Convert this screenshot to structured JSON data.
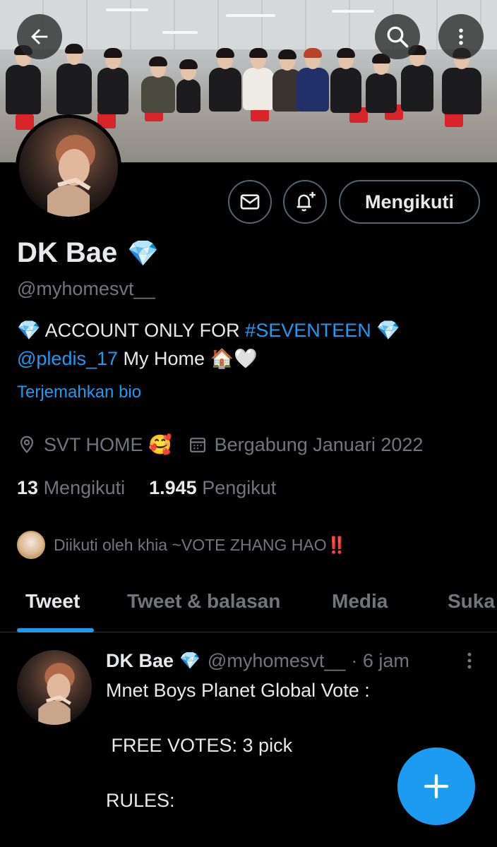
{
  "profile": {
    "name": "DK Bae",
    "verified_emoji": "💎",
    "handle": "@myhomesvt__",
    "follow_label": "Mengikuti",
    "bio_line1_pre": "💎 ACCOUNT ONLY FOR ",
    "bio_hashtag": "#SEVENTEEN",
    "bio_line1_post": " 💎",
    "bio_mention": "@pledis_17",
    "bio_line2_post": " My Home 🏠🤍",
    "translate_label": "Terjemahkan bio",
    "location": "SVT HOME 🥰",
    "joined": "Bergabung Januari 2022",
    "following_count": "13",
    "following_label": "Mengikuti",
    "followers_count": "1.945",
    "followers_label": "Pengikut",
    "followed_by": "Diikuti oleh khia ~VOTE ZHANG HAO‼️"
  },
  "tabs": [
    {
      "label": "Tweet"
    },
    {
      "label": "Tweet & balasan"
    },
    {
      "label": "Media"
    },
    {
      "label": "Suka"
    }
  ],
  "tweet": {
    "name": "DK Bae",
    "verified_emoji": "💎",
    "handle": "@myhomesvt__",
    "time": "· 6 jam",
    "body": "Mnet Boys Planet Global Vote :\n\n FREE VOTES: 3 pick\n\nRULES:"
  },
  "icons": {
    "back": "arrow-left-icon",
    "search": "search-icon",
    "more": "more-vertical-icon",
    "message": "mail-icon",
    "notify": "bell-plus-icon",
    "location": "location-pin-icon",
    "calendar": "calendar-icon",
    "compose": "plus-icon"
  },
  "colors": {
    "accent": "#1d9bf0",
    "background": "#000000",
    "text": "#e7e9ea",
    "muted": "#71767b",
    "border": "#536471"
  }
}
